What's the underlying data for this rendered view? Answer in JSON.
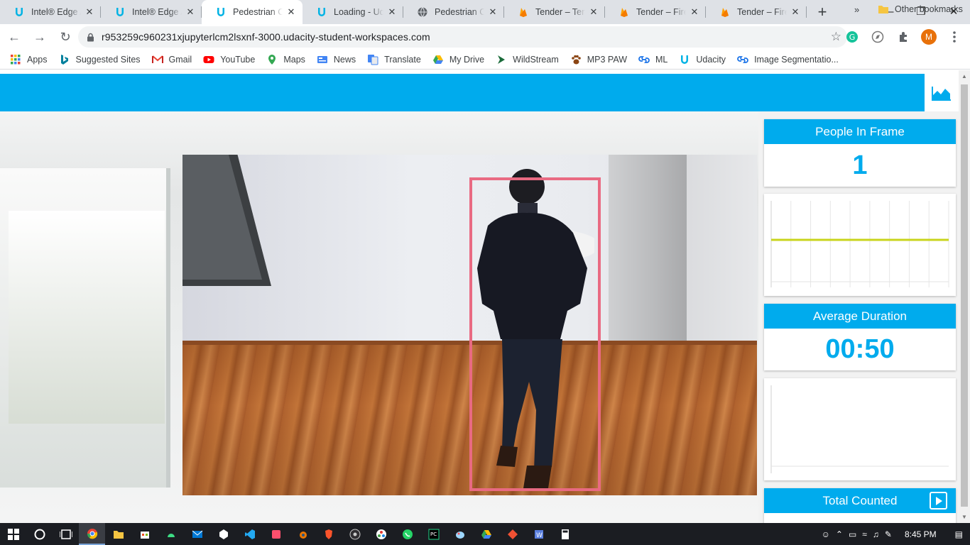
{
  "browser": {
    "tabs": [
      {
        "title": "Intel® Edge AI",
        "icon": "udacity-icon",
        "active": false
      },
      {
        "title": "Intel® Edge AI",
        "icon": "udacity-icon",
        "active": false
      },
      {
        "title": "Pedestrian Cou",
        "icon": "udacity-icon",
        "active": true
      },
      {
        "title": "Loading - Udac",
        "icon": "udacity-icon",
        "active": false
      },
      {
        "title": "Pedestrian Cou",
        "icon": "globe-icon",
        "active": false
      },
      {
        "title": "Tender – Tende",
        "icon": "firebase-icon",
        "active": false
      },
      {
        "title": "Tender – Fireb",
        "icon": "firebase-icon",
        "active": false
      },
      {
        "title": "Tender – Fireb",
        "icon": "firebase-icon",
        "active": false
      }
    ],
    "url": "r953259c960231xjupyterlcm2lsxnf-3000.udacity-student-workspaces.com",
    "profile_initial": "M",
    "bookmarks": [
      {
        "label": "Apps",
        "icon": "apps-grid-icon"
      },
      {
        "label": "Suggested Sites",
        "icon": "bing-icon"
      },
      {
        "label": "Gmail",
        "icon": "gmail-icon"
      },
      {
        "label": "YouTube",
        "icon": "youtube-icon"
      },
      {
        "label": "Maps",
        "icon": "maps-pin-icon"
      },
      {
        "label": "News",
        "icon": "news-icon"
      },
      {
        "label": "Translate",
        "icon": "translate-icon"
      },
      {
        "label": "My Drive",
        "icon": "drive-icon"
      },
      {
        "label": "WildStream",
        "icon": "wildstream-icon"
      },
      {
        "label": "MP3 PAW",
        "icon": "paw-icon"
      },
      {
        "label": "ML",
        "icon": "link-icon"
      },
      {
        "label": "Udacity",
        "icon": "udacity-icon"
      },
      {
        "label": "Image Segmentatio...",
        "icon": "link-icon"
      }
    ],
    "bookmarks_overflow": "»",
    "other_bookmarks": "Other bookmarks"
  },
  "dashboard": {
    "people_in_frame": {
      "label": "People In Frame",
      "value": "1"
    },
    "average_duration": {
      "label": "Average Duration",
      "value": "00:50"
    },
    "total_counted": {
      "label": "Total Counted"
    },
    "people_chart": {
      "type": "line",
      "values": [
        1,
        1,
        1,
        1,
        1,
        1,
        1,
        1
      ],
      "line_color": "#c9d41c",
      "ylim": [
        0,
        2
      ]
    },
    "accent_color": "#00abed",
    "bbox_color": "#e96a82"
  },
  "taskbar": {
    "time": "8:45 PM",
    "apps": [
      "chrome-icon",
      "file-explorer-icon",
      "store-icon",
      "android-studio-icon",
      "mail-icon",
      "unity-icon",
      "vscode-icon",
      "app-icon",
      "blender-icon",
      "brave-icon",
      "obs-icon",
      "color-picker-icon",
      "whatsapp-icon",
      "pycharm-icon",
      "paint-icon",
      "google-drive-icon",
      "git-icon",
      "word-icon",
      "calculator-icon"
    ]
  }
}
